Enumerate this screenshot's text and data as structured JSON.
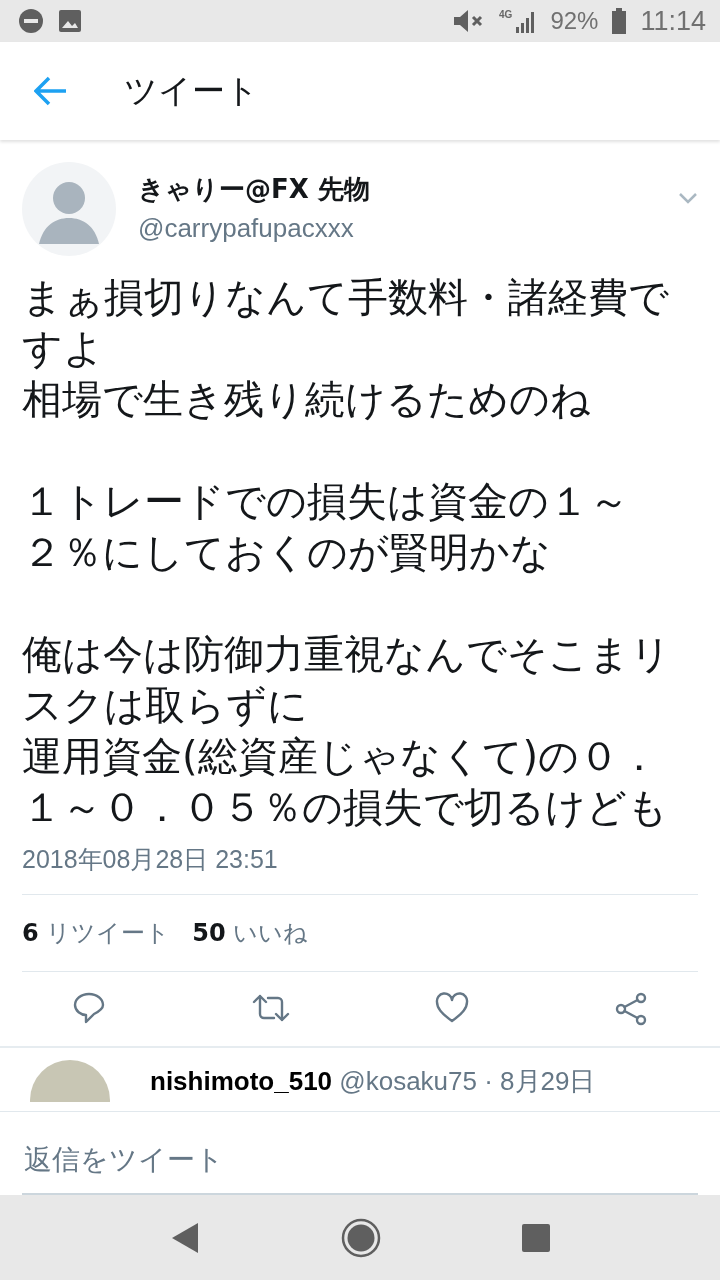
{
  "status_bar": {
    "battery": "92%",
    "network": "4G",
    "time": "11:14"
  },
  "header": {
    "title": "ツイート"
  },
  "tweet": {
    "name": "きゃりー@FX 先物",
    "handle": "@carrypafupacxxx",
    "paragraphs": [
      [
        "まぁ損切りなんて手数料・諸経費ですよ",
        "相場で生き残り続けるためのね"
      ],
      [
        "１トレードでの損失は資金の１～２％にしておくのが賢明かな"
      ],
      [
        "俺は今は防御力重視なんでそこまリスクは取らずに",
        "運用資金(総資産じゃなくて)の０．１～０．０５％の損失で切るけども"
      ]
    ],
    "timestamp": "2018年08月28日 23:51",
    "stats": [
      {
        "count": "6",
        "label": "リツイート"
      },
      {
        "count": "50",
        "label": "いいね"
      }
    ],
    "actions": [
      {
        "kind": "reply"
      },
      {
        "kind": "retweet"
      },
      {
        "kind": "like"
      },
      {
        "kind": "share"
      }
    ]
  },
  "reply_preview": {
    "name": "nishimoto_510",
    "meta": "@kosaku75 · 8月29日"
  },
  "reply_field": {
    "placeholder": "返信をツイート"
  }
}
